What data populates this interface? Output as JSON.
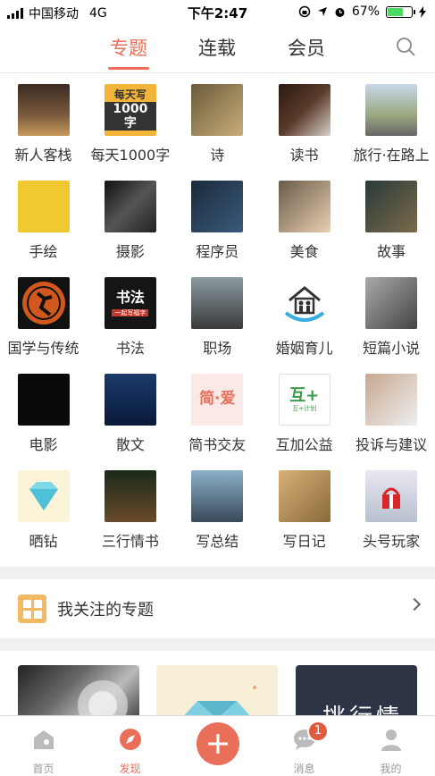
{
  "status": {
    "carrier": "中国移动",
    "network": "4G",
    "time": "下午2:47",
    "battery": "67%",
    "battery_level": 0.67
  },
  "tabs": [
    {
      "label": "专题",
      "active": true
    },
    {
      "label": "连载",
      "active": false
    },
    {
      "label": "会员",
      "active": false
    }
  ],
  "grid": [
    {
      "label": "新人客栈",
      "icon": "inn-photo"
    },
    {
      "label": "每天1000字",
      "icon": "daily-1000-words-logo",
      "thumb_line1": "每天写",
      "thumb_line2": "1000字"
    },
    {
      "label": "诗",
      "icon": "poet-painting"
    },
    {
      "label": "读书",
      "icon": "chocolate-book-photo"
    },
    {
      "label": "旅行·在路上",
      "icon": "road-photo"
    },
    {
      "label": "手绘",
      "icon": "paintbrushes-photo"
    },
    {
      "label": "摄影",
      "icon": "camera-photo"
    },
    {
      "label": "程序员",
      "icon": "programmer-photo"
    },
    {
      "label": "美食",
      "icon": "food-photo"
    },
    {
      "label": "故事",
      "icon": "story-painting"
    },
    {
      "label": "国学与传统",
      "icon": "greek-vase-figure"
    },
    {
      "label": "书法",
      "icon": "calligraphy-logo",
      "thumb_line1": "书法",
      "thumb_line2": "一起写福字"
    },
    {
      "label": "职场",
      "icon": "office-photo"
    },
    {
      "label": "婚姻育儿",
      "icon": "family-house-icon"
    },
    {
      "label": "短篇小说",
      "icon": "typewriter-photo"
    },
    {
      "label": "电影",
      "icon": "godfather-photo"
    },
    {
      "label": "散文",
      "icon": "moonlit-sea-photo"
    },
    {
      "label": "简书交友",
      "icon": "jianshu-love-logo",
      "thumb_line1": "简·爱"
    },
    {
      "label": "互加公益",
      "icon": "hujia-charity-logo",
      "thumb_line1": "互+",
      "thumb_line2": "互+计划"
    },
    {
      "label": "投诉与建议",
      "icon": "woman-smile-photo"
    },
    {
      "label": "晒钻",
      "icon": "diamond-icon"
    },
    {
      "label": "三行情书",
      "icon": "night-street-photo"
    },
    {
      "label": "写总结",
      "icon": "cliff-sea-photo"
    },
    {
      "label": "写日记",
      "icon": "notebook-photo"
    },
    {
      "label": "头号玩家",
      "icon": "gift-photo"
    }
  ],
  "follow": {
    "label": "我关注的专题"
  },
  "cards": [
    {
      "icon": "dandelion-photo"
    },
    {
      "icon": "diamond-illustration"
    },
    {
      "icon": "dark-title-card",
      "text": "挑行情"
    }
  ],
  "nav": [
    {
      "label": "首页",
      "icon": "home-icon",
      "active": false
    },
    {
      "label": "发现",
      "icon": "compass-icon",
      "active": true
    },
    {
      "label": "",
      "icon": "plus-icon",
      "active": false
    },
    {
      "label": "消息",
      "icon": "message-icon",
      "active": false,
      "badge": "1"
    },
    {
      "label": "我的",
      "icon": "profile-icon",
      "active": false
    }
  ],
  "colors": {
    "accent": "#ea6f5a",
    "follow_icon": "#f0b962"
  }
}
